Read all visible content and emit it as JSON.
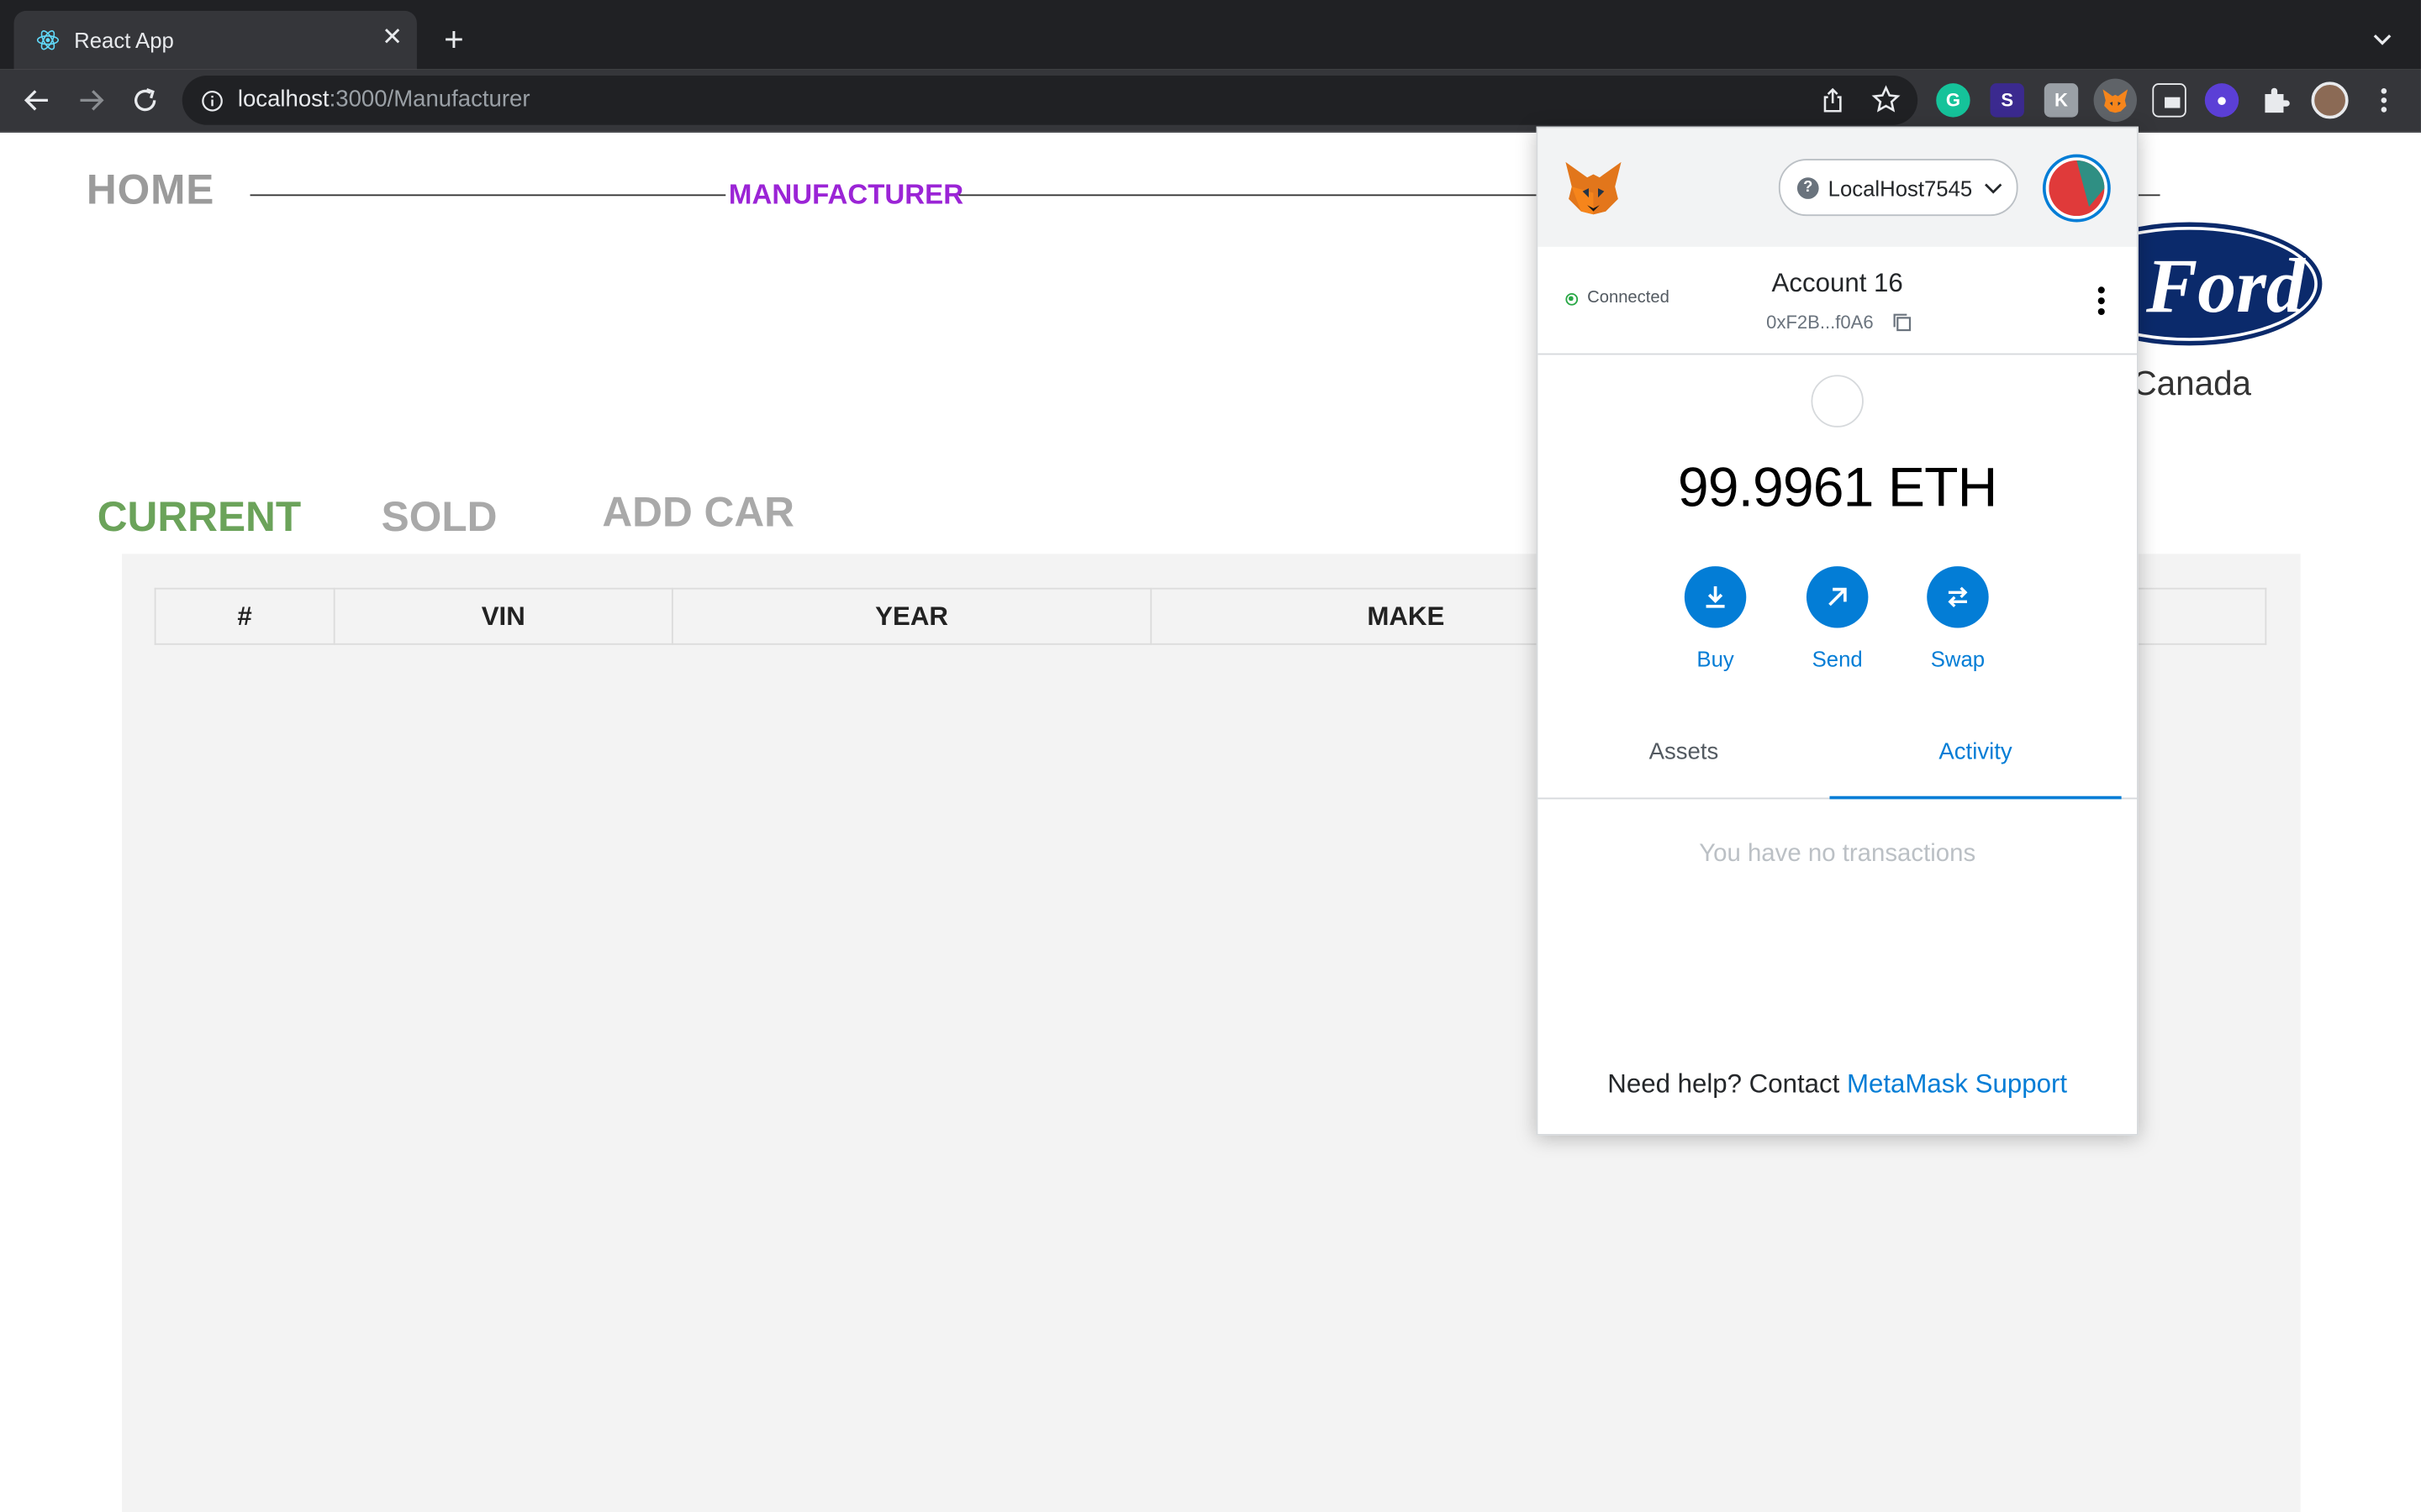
{
  "browser": {
    "tab_title": "React App",
    "url_host": "localhost",
    "url_rest": ":3000/Manufacturer"
  },
  "page": {
    "home_label": "HOME",
    "manufacturer_label": "MANUFACTURER",
    "brand_subtitle": "Canada",
    "tabs": {
      "current": "CURRENT",
      "sold": "SOLD",
      "add_car": "ADD CAR"
    },
    "table": {
      "columns": [
        "#",
        "VIN",
        "YEAR",
        "MAKE"
      ]
    }
  },
  "metamask": {
    "network": "LocalHost7545",
    "connection_status": "Connected",
    "account_name": "Account 16",
    "account_address": "0xF2B...f0A6",
    "balance": "99.9961 ETH",
    "actions": {
      "buy": "Buy",
      "send": "Send",
      "swap": "Swap"
    },
    "tabs": {
      "assets": "Assets",
      "activity": "Activity"
    },
    "empty_message": "You have no transactions",
    "help_prefix": "Need help? Contact ",
    "help_link": "MetaMask Support"
  },
  "colors": {
    "manufacturer_accent": "#9b24d6",
    "current_tab": "#6ba35a",
    "metamask_blue": "#037dd6",
    "ford_blue": "#0b2a6b"
  }
}
